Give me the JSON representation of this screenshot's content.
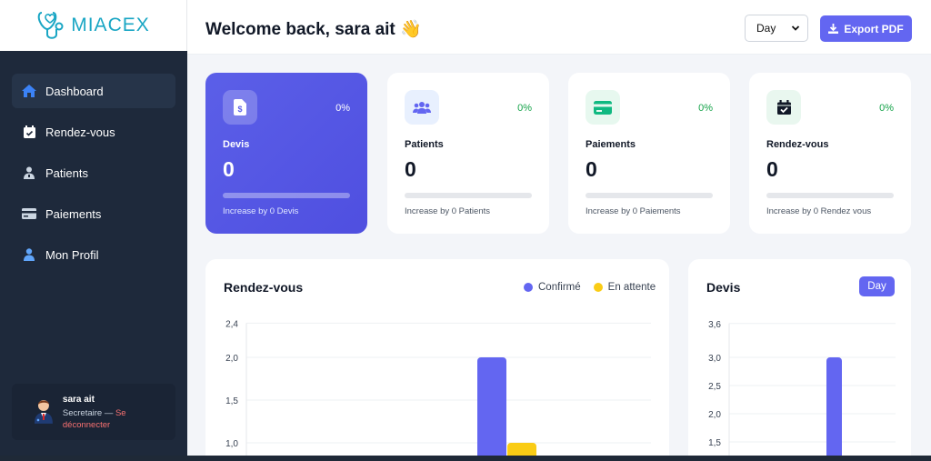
{
  "app": {
    "brand": "MIACEX"
  },
  "sidebar": {
    "items": [
      {
        "label": "Dashboard",
        "icon": "home-icon",
        "active": true
      },
      {
        "label": "Rendez-vous",
        "icon": "calendar-check-icon"
      },
      {
        "label": "Patients",
        "icon": "user-doctor-icon"
      },
      {
        "label": "Paiements",
        "icon": "credit-card-icon"
      },
      {
        "label": "Mon Profil",
        "icon": "user-icon"
      }
    ],
    "user": {
      "name": "sara ait",
      "role": "Secretaire — ",
      "logout": "Se déconnecter"
    }
  },
  "header": {
    "welcome": "Welcome back, sara ait 👋",
    "period_select": "Day",
    "export_label": "Export PDF"
  },
  "stats": [
    {
      "label": "Devis",
      "value": "0",
      "percent": "0%",
      "increase": "Increase by 0 Devis",
      "icon": "invoice-icon",
      "progress": 0
    },
    {
      "label": "Patients",
      "value": "0",
      "percent": "0%",
      "increase": "Increase by 0 Patients",
      "icon": "users-icon",
      "progress": 0
    },
    {
      "label": "Paiements",
      "value": "0",
      "percent": "0%",
      "increase": "Increase by 0 Paiements",
      "icon": "credit-card-icon",
      "progress": 0
    },
    {
      "label": "Rendez-vous",
      "value": "0",
      "percent": "0%",
      "increase": "Increase by 0 Rendez vous",
      "icon": "calendar-check-icon",
      "progress": 0
    }
  ],
  "colors": {
    "accent": "#6366f1",
    "confirmed": "#6366f1",
    "pending": "#facc15",
    "sidebar": "#1e293b",
    "positive": "#16a34a",
    "logout": "#f87171"
  },
  "chart_data": [
    {
      "type": "bar",
      "title": "Rendez-vous",
      "series": [
        {
          "name": "Confirmé",
          "values": [
            2.0
          ]
        },
        {
          "name": "En attente",
          "values": [
            1.0
          ]
        }
      ],
      "yticks": [
        "2,4",
        "2,0",
        "1,5",
        "1,0"
      ],
      "ylim": [
        0,
        2.4
      ],
      "legend": "top-right",
      "grid": true
    },
    {
      "type": "bar",
      "title": "Devis",
      "values": [
        3.0
      ],
      "yticks": [
        "3,6",
        "3,0",
        "2,5",
        "2,0",
        "1,5"
      ],
      "ylim": [
        0,
        3.6
      ],
      "filter_label": "Day",
      "grid": true
    }
  ]
}
